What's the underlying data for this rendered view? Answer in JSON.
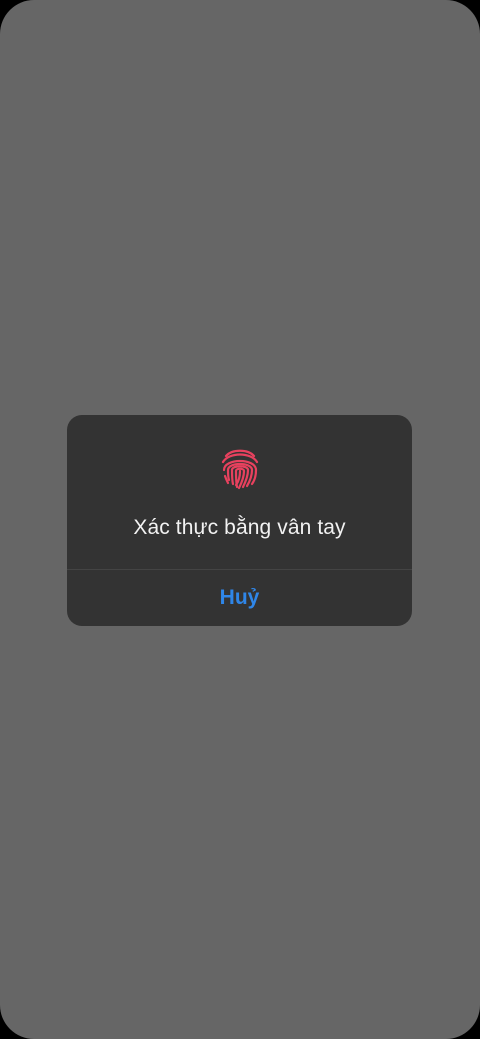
{
  "dialog": {
    "title": "Xác thực bằng vân tay",
    "cancel_label": "Huỷ",
    "icon": "fingerprint-icon"
  },
  "colors": {
    "background": "#666666",
    "dialog_background": "#333333",
    "fingerprint": "#e8415e",
    "cancel_text": "#2f86e8",
    "title_text": "#f2f2f2",
    "divider": "#444444"
  }
}
